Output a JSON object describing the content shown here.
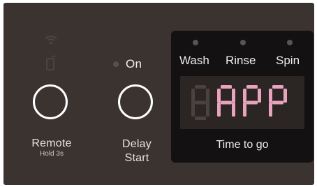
{
  "panel": {
    "on_label": "On",
    "remote": {
      "label": "Remote",
      "sublabel": "Hold 3s"
    },
    "delay_start": {
      "label_line1": "Delay",
      "label_line2": "Start"
    }
  },
  "display": {
    "phases": [
      "Wash",
      "Rinse",
      "Spin"
    ],
    "segment_text": "APP",
    "caption": "Time to go"
  },
  "colors": {
    "panel_bg": "#3b3330",
    "display_bg": "#141112",
    "lcd_bg": "#2b2624",
    "segment_lit": "#e9a3be",
    "segment_unlit": "#4a4240"
  },
  "icons": [
    "wifi-icon",
    "phone-icon"
  ]
}
